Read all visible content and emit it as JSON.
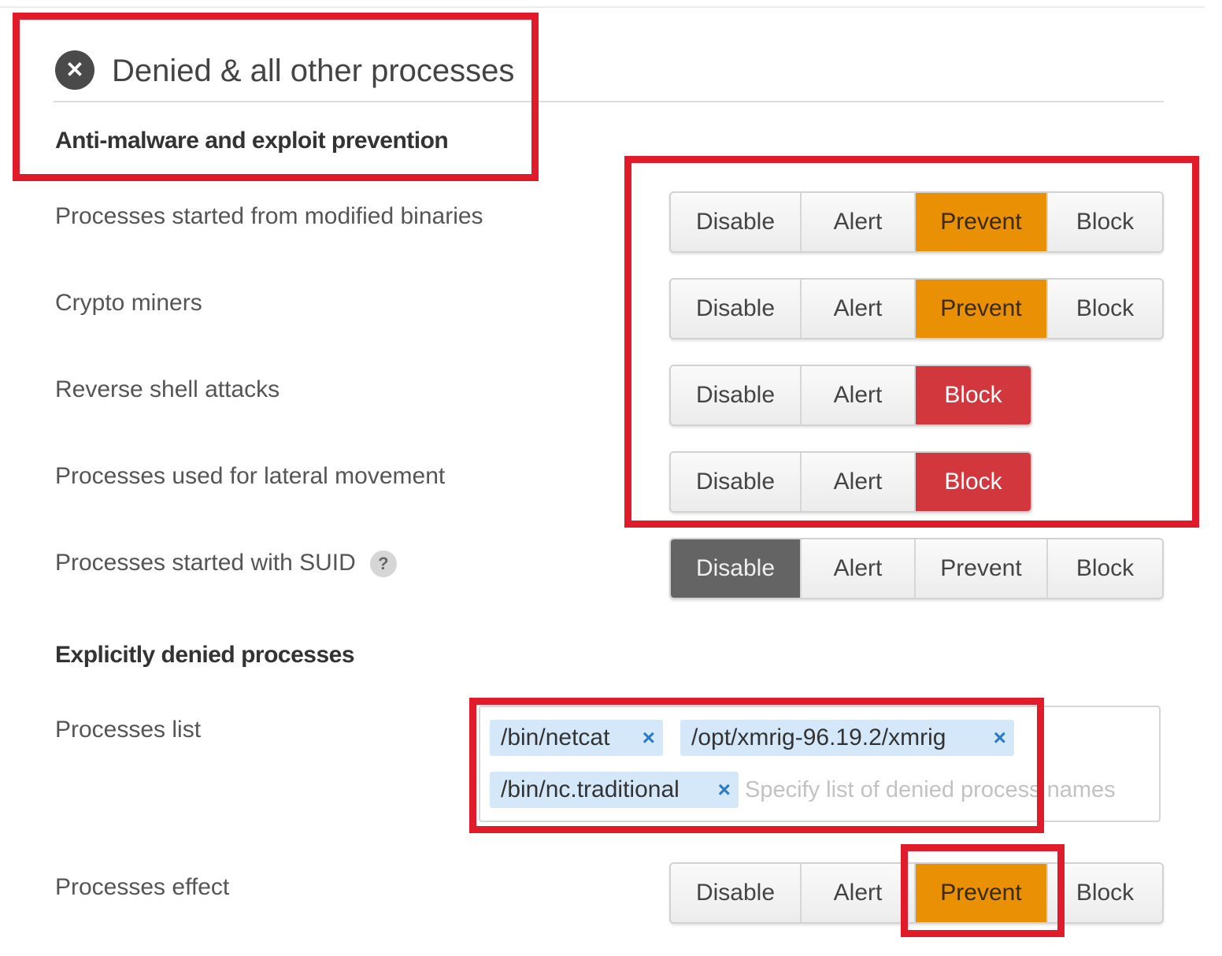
{
  "section": {
    "icon": "close-circle-icon",
    "title": "Denied & all other processes"
  },
  "antimalware": {
    "heading": "Anti-malware and exploit prevention",
    "rows": [
      {
        "label": "Processes started from modified binaries",
        "options": [
          "Disable",
          "Alert",
          "Prevent",
          "Block"
        ],
        "selected": "Prevent"
      },
      {
        "label": "Crypto miners",
        "options": [
          "Disable",
          "Alert",
          "Prevent",
          "Block"
        ],
        "selected": "Prevent"
      },
      {
        "label": "Reverse shell attacks",
        "options": [
          "Disable",
          "Alert",
          "Block"
        ],
        "selected": "Block"
      },
      {
        "label": "Processes used for lateral movement",
        "options": [
          "Disable",
          "Alert",
          "Block"
        ],
        "selected": "Block"
      },
      {
        "label": "Processes started with SUID",
        "help": "?",
        "options": [
          "Disable",
          "Alert",
          "Prevent",
          "Block"
        ],
        "selected": "Disable"
      }
    ]
  },
  "denied": {
    "heading": "Explicitly denied processes",
    "list_label": "Processes list",
    "tags": [
      "/bin/netcat",
      "/opt/xmrig-96.19.2/xmrig",
      "/bin/nc.traditional"
    ],
    "remove_symbol": "×",
    "placeholder": "Specify list of denied process names",
    "effect_label": "Processes effect",
    "effect_options": [
      "Disable",
      "Alert",
      "Prevent",
      "Block"
    ],
    "effect_selected": "Prevent"
  },
  "colors": {
    "prevent_active": "#ea9004",
    "block_active": "#d1373d",
    "disable_active": "#646464",
    "highlight_box": "#e11b2a",
    "tag_background": "#d4e8fa"
  }
}
